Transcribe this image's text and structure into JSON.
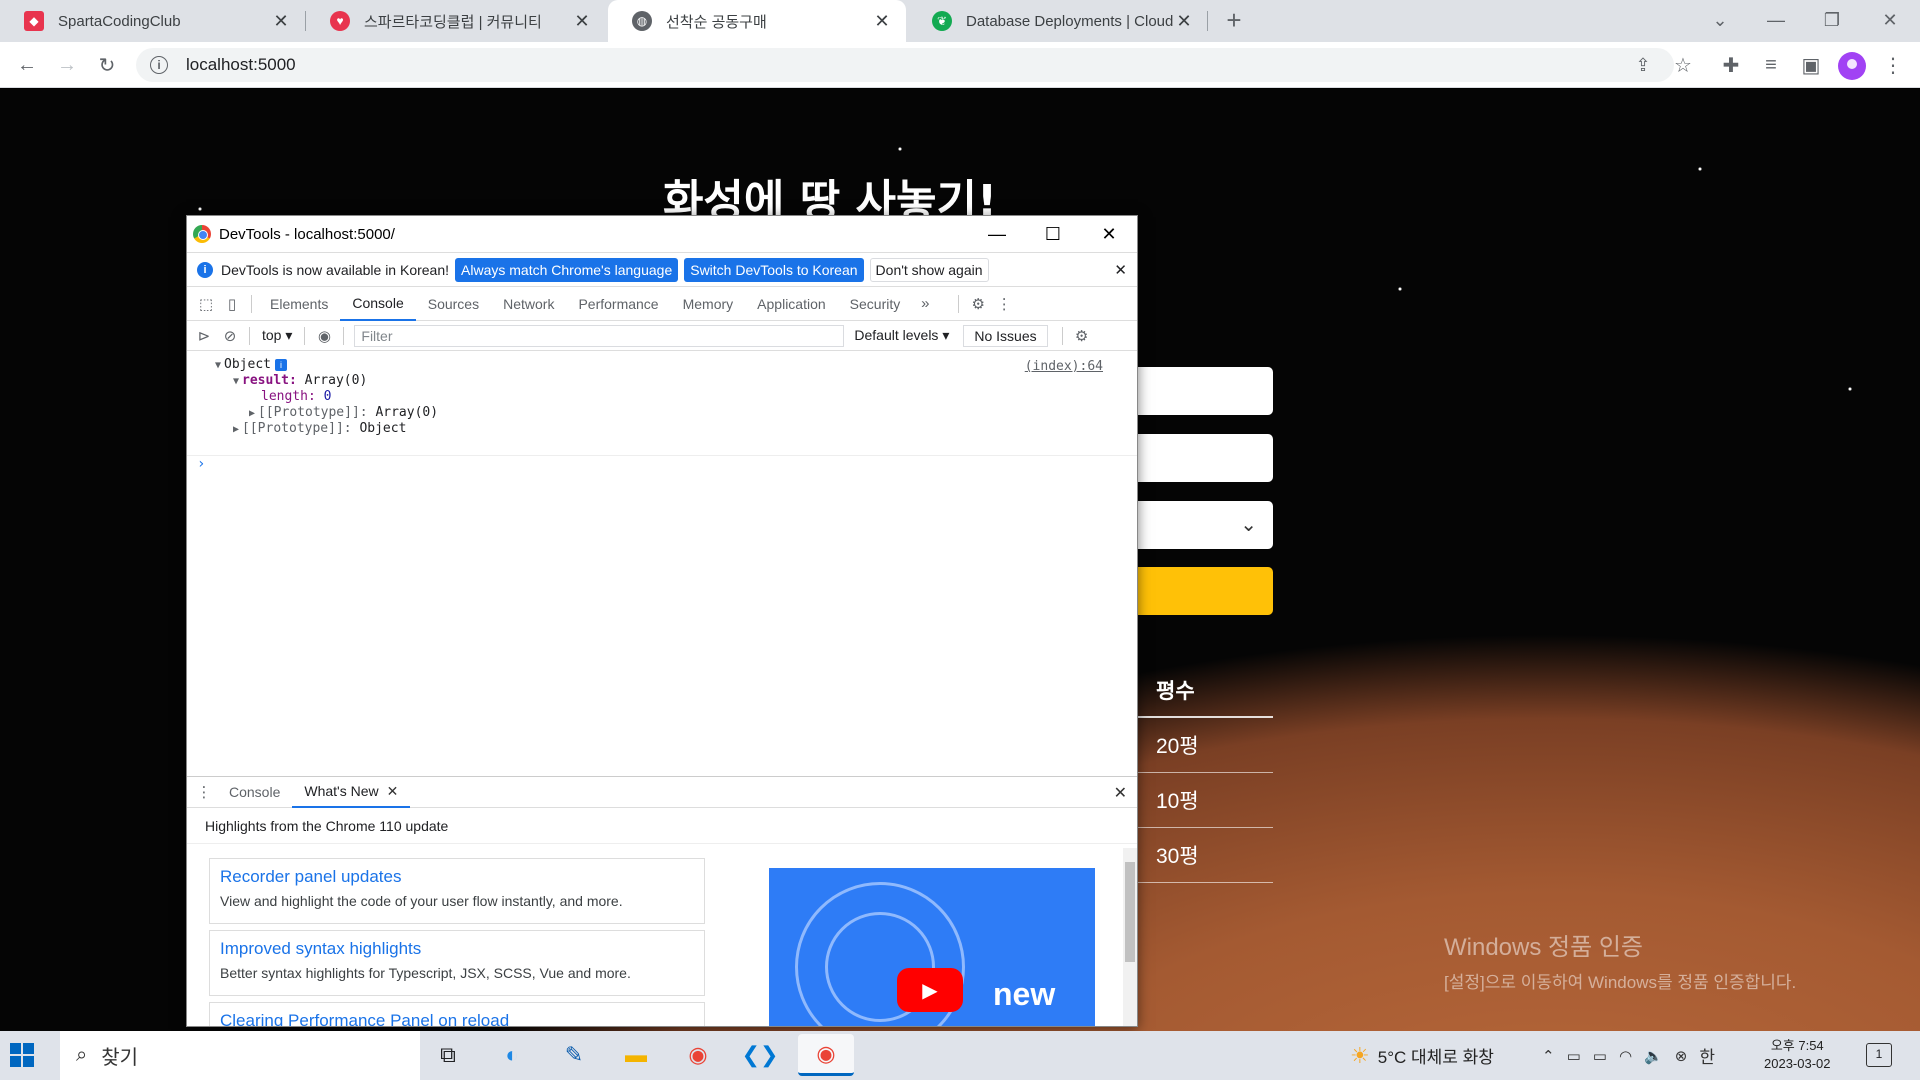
{
  "browser": {
    "tabs": [
      {
        "label": "SpartaCodingClub",
        "favicon_color": "#e8344e"
      },
      {
        "label": "스파르타코딩클럽 | 커뮤니티",
        "favicon_color": "#e8344e"
      },
      {
        "label": "선착순 공동구매",
        "favicon_color": "#5f6368",
        "active": true
      },
      {
        "label": "Database Deployments | Cloud:",
        "favicon_color": "#13aa52"
      }
    ],
    "url": "localhost:5000"
  },
  "page": {
    "title": "화성에 땅 사놓기!",
    "table_header": "평수",
    "table_rows": [
      "20평",
      "10평",
      "30평"
    ],
    "watermark_line1": "Windows 정품 인증",
    "watermark_line2": "[설정]으로 이동하여 Windows를 정품 인증합니다."
  },
  "devtools": {
    "window_title": "DevTools - localhost:5000/",
    "infobar": {
      "message": "DevTools is now available in Korean!",
      "btn_match": "Always match Chrome's language",
      "btn_switch": "Switch DevTools to Korean",
      "btn_dismiss": "Don't show again"
    },
    "tabs": [
      "Elements",
      "Console",
      "Sources",
      "Network",
      "Performance",
      "Memory",
      "Application",
      "Security"
    ],
    "active_tab": "Console",
    "console_bar": {
      "context": "top",
      "filter_placeholder": "Filter",
      "levels": "Default levels",
      "issues": "No Issues"
    },
    "console_lines": {
      "object": "Object",
      "result_key": "result:",
      "result_val": "Array(0)",
      "length_key": "length:",
      "length_val": "0",
      "proto1_key": "[[Prototype]]:",
      "proto1_val": "Array(0)",
      "proto2_key": "[[Prototype]]:",
      "proto2_val": "Object",
      "source": "(index):64"
    },
    "drawer": {
      "tabs": [
        "Console",
        "What's New"
      ],
      "heading": "Highlights from the Chrome 110 update",
      "cards": [
        {
          "title": "Recorder panel updates",
          "desc": "View and highlight the code of your user flow instantly, and more."
        },
        {
          "title": "Improved syntax highlights",
          "desc": "Better syntax highlights for Typescript, JSX, SCSS, Vue and more."
        },
        {
          "title": "Clearing Performance Panel on reload",
          "desc": ""
        }
      ],
      "video_label": "new"
    }
  },
  "taskbar": {
    "search_label": "찾기",
    "weather": "5°C  대체로 화창",
    "ime": "한",
    "time": "오후 7:54",
    "date": "2023-03-02",
    "notification_count": "1"
  }
}
